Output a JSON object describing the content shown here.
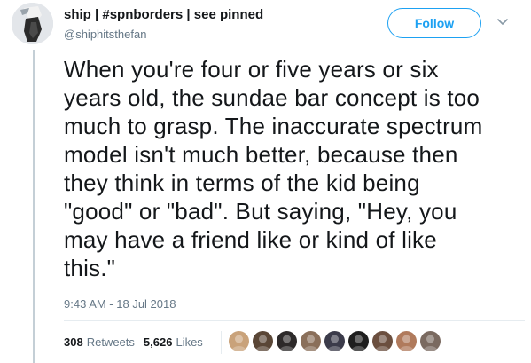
{
  "author": {
    "display_name": "ship | #spnborders | see pinned",
    "handle": "@shiphitsthefan",
    "avatar_icon": "user-avatar"
  },
  "follow_label": "Follow",
  "tweet": {
    "text": "When you're four or five years or six\nyears old, the sundae bar concept is too\nmuch to grasp. The inaccurate spectrum\nmodel isn't much better, because then\nthey think in terms of the kid being\n\"good\" or \"bad\". But saying, \"Hey, you\nmay have a friend like or kind of like\nthis.\"",
    "timestamp": "9:43 AM - 18 Jul 2018"
  },
  "stats": {
    "retweets_count": "308",
    "retweets_label": "Retweets",
    "likes_count": "5,626",
    "likes_label": "Likes"
  },
  "likers": [
    {
      "color": "#c9a27a"
    },
    {
      "color": "#5a4636"
    },
    {
      "color": "#2d2a2a"
    },
    {
      "color": "#8a6f5a"
    },
    {
      "color": "#3b3b4a"
    },
    {
      "color": "#1f1f1f"
    },
    {
      "color": "#6b4f3f"
    },
    {
      "color": "#b07a5c"
    },
    {
      "color": "#7a6a60"
    }
  ],
  "colors": {
    "accent": "#1da1f2",
    "secondary_text": "#657786",
    "primary_text": "#14171a",
    "thread_line": "#c4cfd6"
  }
}
